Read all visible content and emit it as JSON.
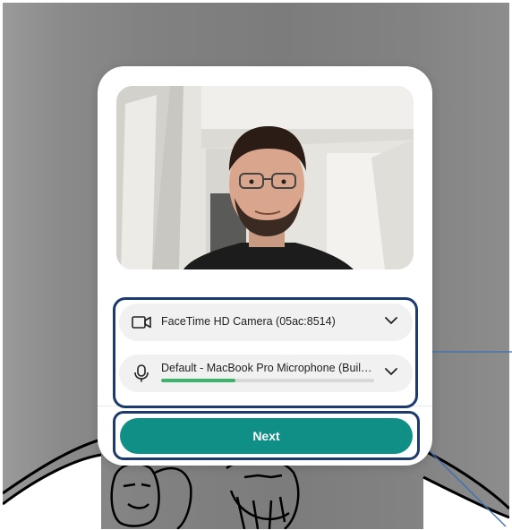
{
  "camera": {
    "label": "FaceTime HD Camera (05ac:8514)",
    "icon": "video-camera-icon"
  },
  "microphone": {
    "label": "Default - MacBook Pro Microphone (Buil…",
    "icon": "microphone-icon",
    "level": 0.35
  },
  "next_button": {
    "label": "Next"
  },
  "colors": {
    "accent": "#0f8f86",
    "mic_level": "#3bb56a",
    "highlight": "#1d3a6e"
  }
}
